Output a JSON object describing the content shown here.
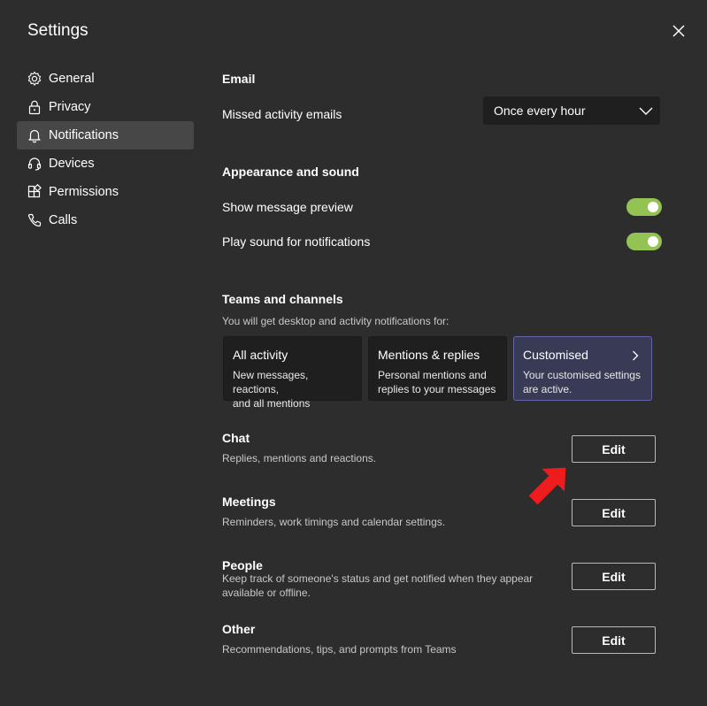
{
  "window": {
    "title": "Settings"
  },
  "sidebar": {
    "items": [
      {
        "label": "General",
        "icon": "gear-icon"
      },
      {
        "label": "Privacy",
        "icon": "lock-icon"
      },
      {
        "label": "Notifications",
        "icon": "bell-icon",
        "active": true
      },
      {
        "label": "Devices",
        "icon": "headset-icon"
      },
      {
        "label": "Permissions",
        "icon": "apps-icon"
      },
      {
        "label": "Calls",
        "icon": "phone-icon"
      }
    ]
  },
  "email": {
    "heading": "Email",
    "missed_label": "Missed activity emails",
    "missed_value": "Once every hour"
  },
  "appearance": {
    "heading": "Appearance and sound",
    "preview_label": "Show message preview",
    "preview_on": true,
    "sound_label": "Play sound for notifications",
    "sound_on": true
  },
  "teams": {
    "heading": "Teams and channels",
    "description": "You will get desktop and activity notifications for:",
    "cards": [
      {
        "title": "All activity",
        "line1": "New messages, reactions,",
        "line2": "and all mentions"
      },
      {
        "title": "Mentions & replies",
        "line1": "Personal mentions and",
        "line2": "replies to your messages"
      },
      {
        "title": "Customised",
        "line1": "Your customised settings",
        "line2": "are active.",
        "selected": true
      }
    ]
  },
  "sections": [
    {
      "heading": "Chat",
      "line1": "Replies, mentions and reactions.",
      "line2": "",
      "button": "Edit"
    },
    {
      "heading": "Meetings",
      "line1": "Reminders, work timings and calendar settings.",
      "line2": "",
      "button": "Edit"
    },
    {
      "heading": "People",
      "line1": "Keep track of someone's status and get notified when they appear",
      "line2": "available or offline.",
      "button": "Edit"
    },
    {
      "heading": "Other",
      "line1": "Recommendations, tips, and prompts from Teams",
      "line2": "",
      "button": "Edit"
    }
  ],
  "colors": {
    "background": "#2d2d2d",
    "toggle_on": "#92c353",
    "selected_card": "#393a55",
    "selected_border": "#6264a7",
    "annotation_arrow": "#ee1c1c"
  }
}
